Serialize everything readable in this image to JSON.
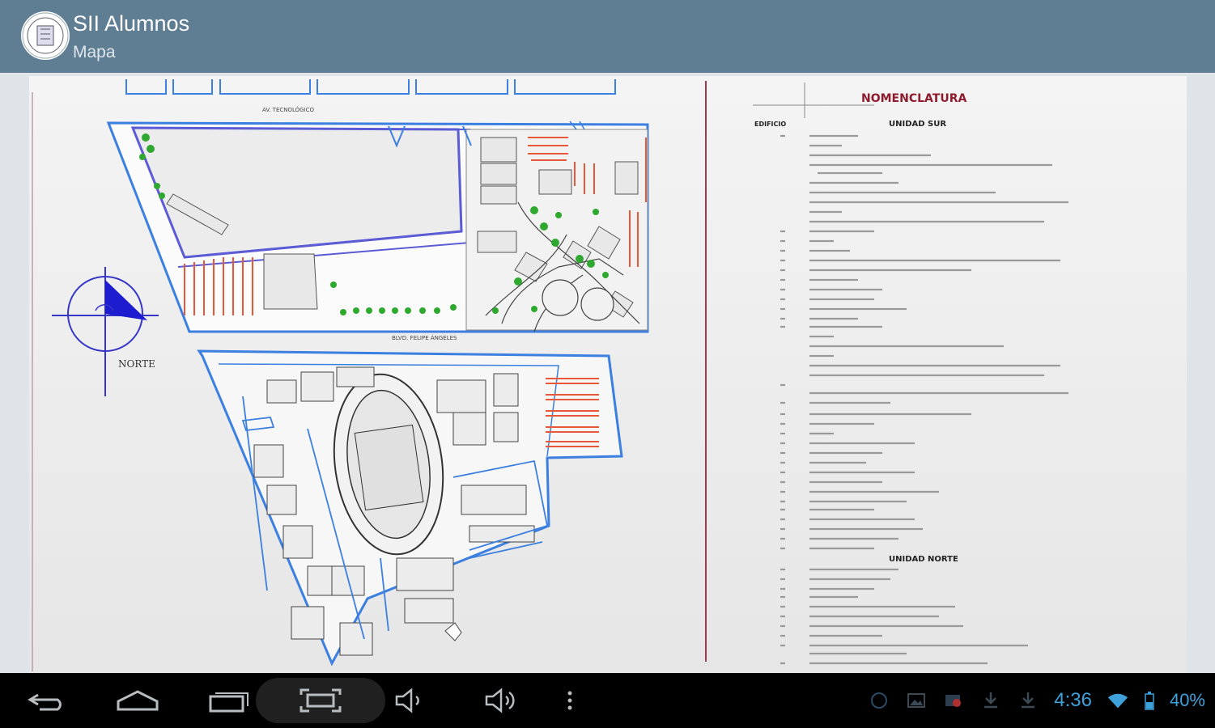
{
  "app": {
    "title": "SII Alumnos",
    "subtitle": "Mapa"
  },
  "map": {
    "heading": "NOMENCLATURA",
    "north_label": "NORTE",
    "unit_sur_label": "UNIDAD SUR",
    "unit_norte_label": "UNIDAD NORTE",
    "column_label": "EDIFICIO"
  },
  "status": {
    "time": "4:36",
    "battery": "40%"
  },
  "colors": {
    "appbar": "#5f7e94",
    "accent": "#3ea1d9",
    "plan_blue": "#3b7fe0",
    "parking_red": "#e7583a",
    "trees": "#2fa82f"
  }
}
